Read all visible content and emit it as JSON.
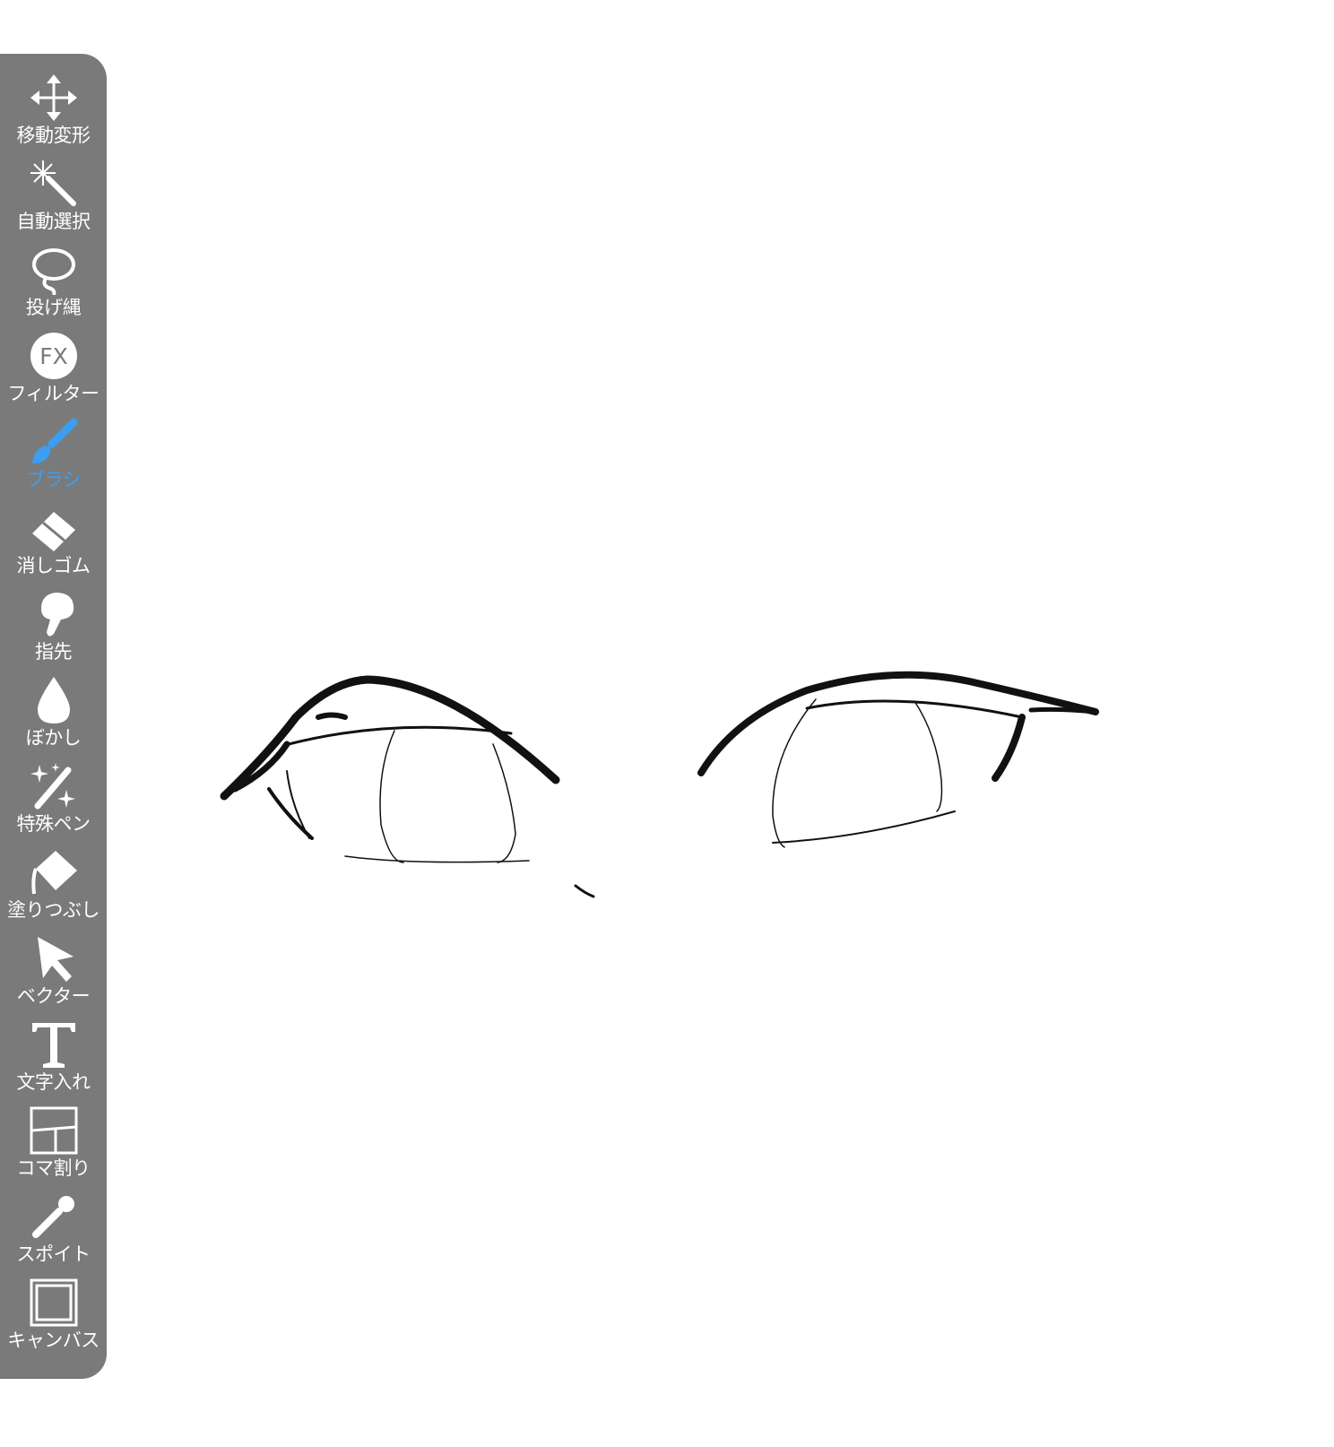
{
  "toolbar": {
    "accent_color": "#3d9df0",
    "background_color": "#7a7a7a",
    "tools": [
      {
        "label": "移動変形",
        "icon": "move-arrows-icon",
        "active": false
      },
      {
        "label": "自動選択",
        "icon": "magic-wand-icon",
        "active": false
      },
      {
        "label": "投げ縄",
        "icon": "lasso-icon",
        "active": false
      },
      {
        "label": "フィルター",
        "icon": "fx-icon",
        "active": false
      },
      {
        "label": "ブラシ",
        "icon": "brush-icon",
        "active": true
      },
      {
        "label": "消しゴム",
        "icon": "eraser-icon",
        "active": false
      },
      {
        "label": "指先",
        "icon": "finger-icon",
        "active": false
      },
      {
        "label": "ぼかし",
        "icon": "drop-icon",
        "active": false
      },
      {
        "label": "特殊ペン",
        "icon": "sparkle-pen-icon",
        "active": false
      },
      {
        "label": "塗りつぶし",
        "icon": "paint-bucket-icon",
        "active": false
      },
      {
        "label": "ベクター",
        "icon": "vector-cursor-icon",
        "active": false
      },
      {
        "label": "文字入れ",
        "icon": "text-t-icon",
        "active": false
      },
      {
        "label": "コマ割り",
        "icon": "panel-grid-icon",
        "active": false
      },
      {
        "label": "スポイト",
        "icon": "eyedropper-icon",
        "active": false
      },
      {
        "label": "キャンバス",
        "icon": "canvas-frame-icon",
        "active": false
      }
    ],
    "fx_icon_text": "FX"
  }
}
